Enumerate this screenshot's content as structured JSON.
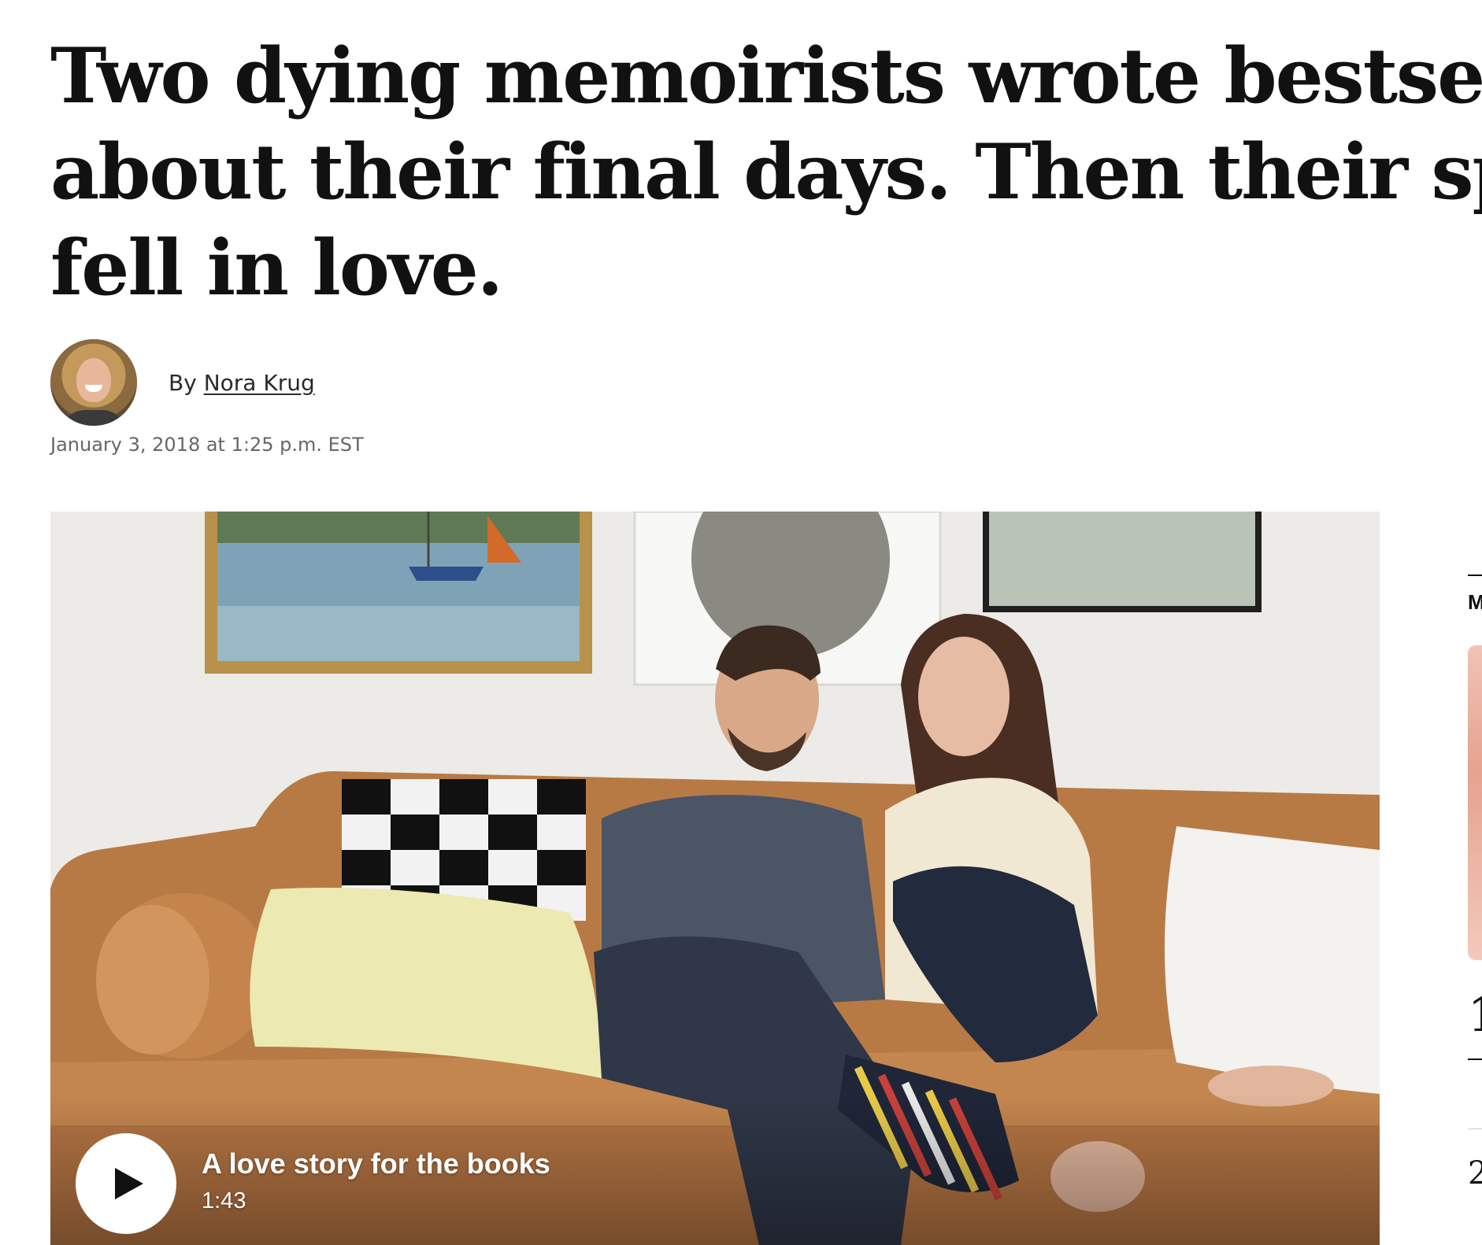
{
  "article": {
    "headline_lines": [
      "Two dying memoirists wrote bestsellers",
      "about their final days. Then their spouses",
      "fell in love."
    ],
    "byline_prefix": "By ",
    "author": "Nora Krug",
    "timestamp": "January 3, 2018 at 1:25 p.m. EST"
  },
  "video": {
    "title": "A love story for the books",
    "duration": "1:43"
  },
  "rail": {
    "section_label_fragment": "M",
    "rank_1": "1",
    "rank_2": "2"
  },
  "colors": {
    "text": "#111111",
    "meta": "#666666",
    "background": "#ffffff"
  }
}
